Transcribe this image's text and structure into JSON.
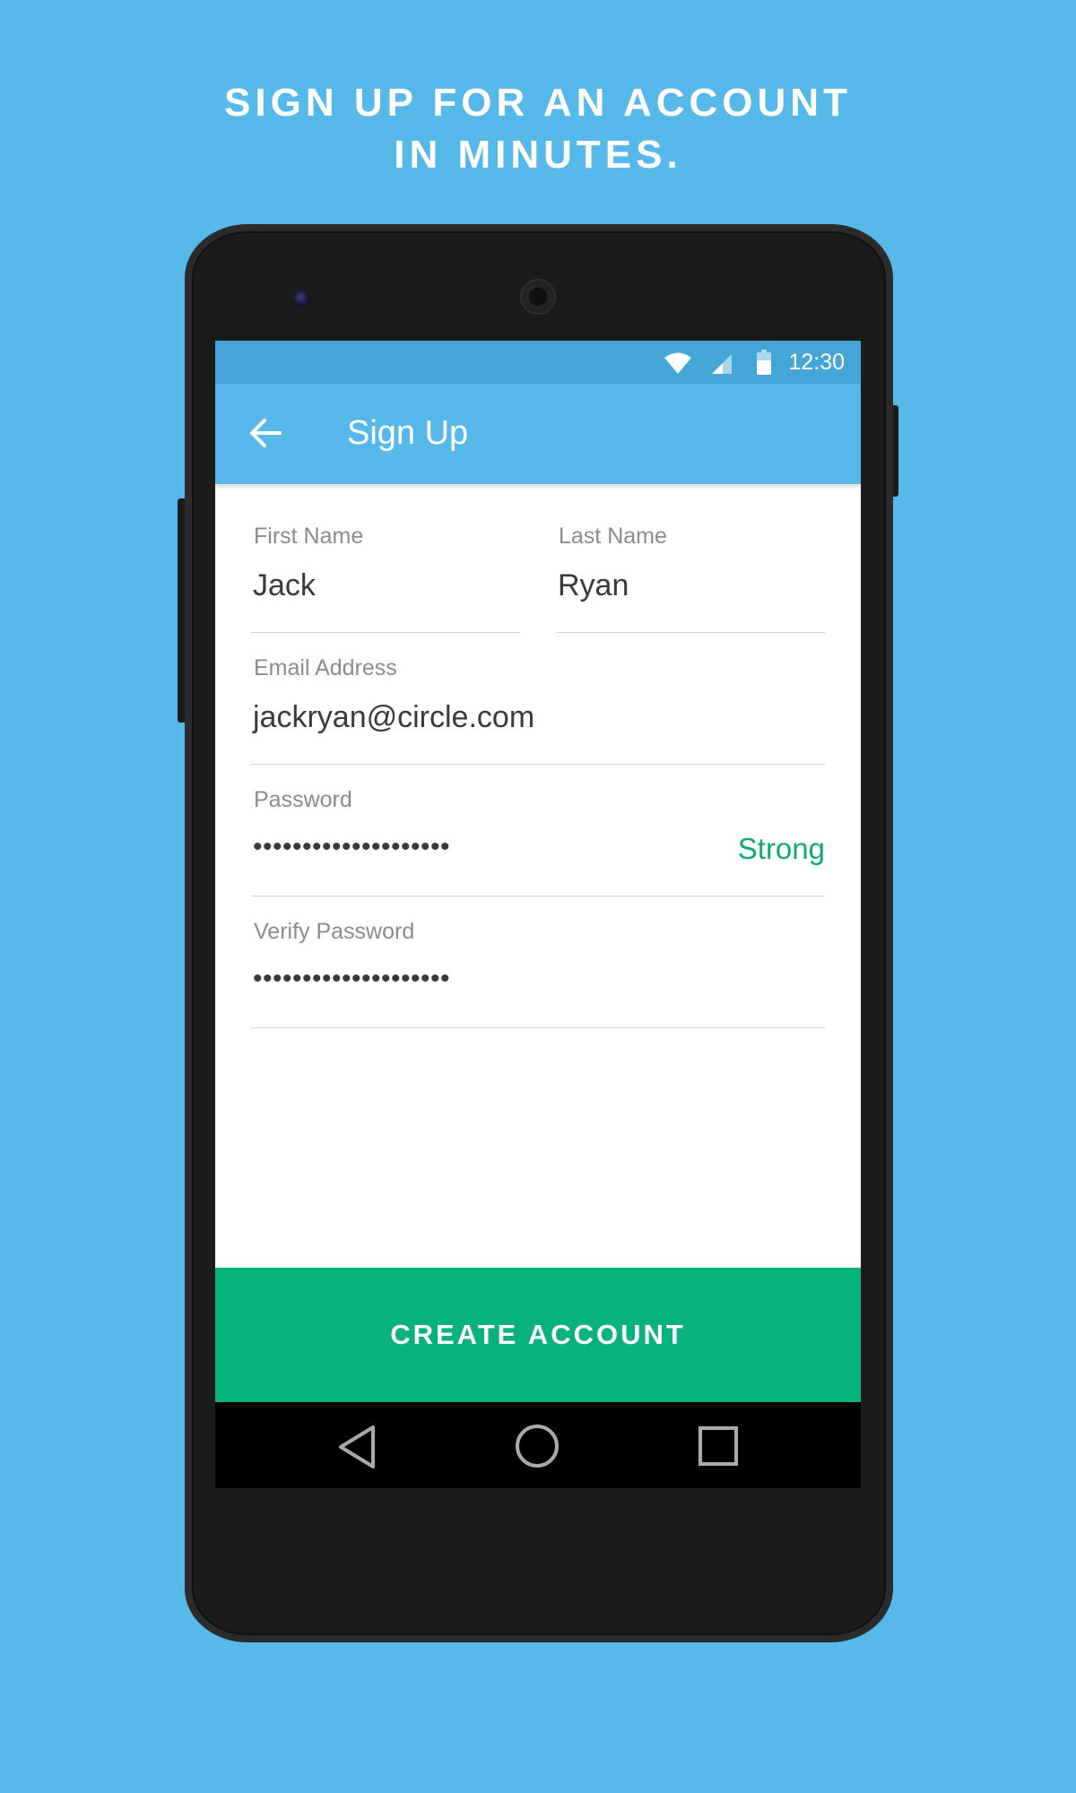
{
  "headline": {
    "line1": "SIGN UP FOR AN ACCOUNT",
    "line2": "IN MINUTES."
  },
  "status_bar": {
    "time": "12:30",
    "icons": [
      "wifi-icon",
      "cell-signal-icon",
      "battery-icon"
    ]
  },
  "app_bar": {
    "title": "Sign Up",
    "back_icon": "arrow-left-icon"
  },
  "form": {
    "first_name": {
      "label": "First Name",
      "value": "Jack"
    },
    "last_name": {
      "label": "Last Name",
      "value": "Ryan"
    },
    "email": {
      "label": "Email Address",
      "value": "jackryan@circle.com"
    },
    "password": {
      "label": "Password",
      "value": "••••••••••••••••••••",
      "strength": "Strong"
    },
    "verify_password": {
      "label": "Verify Password",
      "value": "••••••••••••••••••••"
    }
  },
  "submit": {
    "label": "CREATE ACCOUNT"
  },
  "nav_bar": {
    "icons": [
      "nav-back-icon",
      "nav-home-icon",
      "nav-recents-icon"
    ]
  },
  "colors": {
    "background": "#56b9ea",
    "status_bar": "#43a6d6",
    "app_bar": "#56b9ea",
    "accent_green": "#08b27c",
    "strength_text": "#11aa77",
    "label_gray": "#8c8c8c",
    "value_dark": "#3a3a3a"
  }
}
